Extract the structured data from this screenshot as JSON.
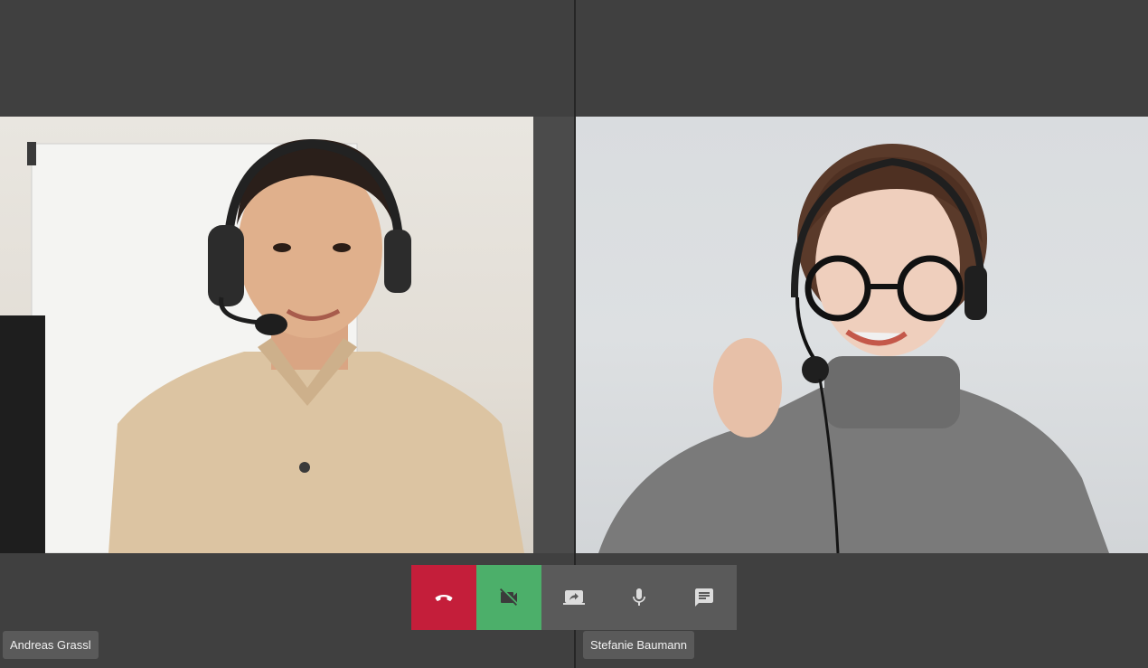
{
  "participants": [
    {
      "name": "Andreas Grassl"
    },
    {
      "name": "Stefanie Baumann"
    }
  ],
  "controls": [
    {
      "icon": "phone-hangup-icon",
      "color": "#c41e3a"
    },
    {
      "icon": "video-off-icon",
      "color": "#4caf6a"
    },
    {
      "icon": "screen-share-icon"
    },
    {
      "icon": "microphone-icon"
    },
    {
      "icon": "chat-icon"
    }
  ],
  "colors": {
    "background": "#404040",
    "control_bar": "#5a5a5a",
    "name_tag": "#5a5a5a"
  }
}
